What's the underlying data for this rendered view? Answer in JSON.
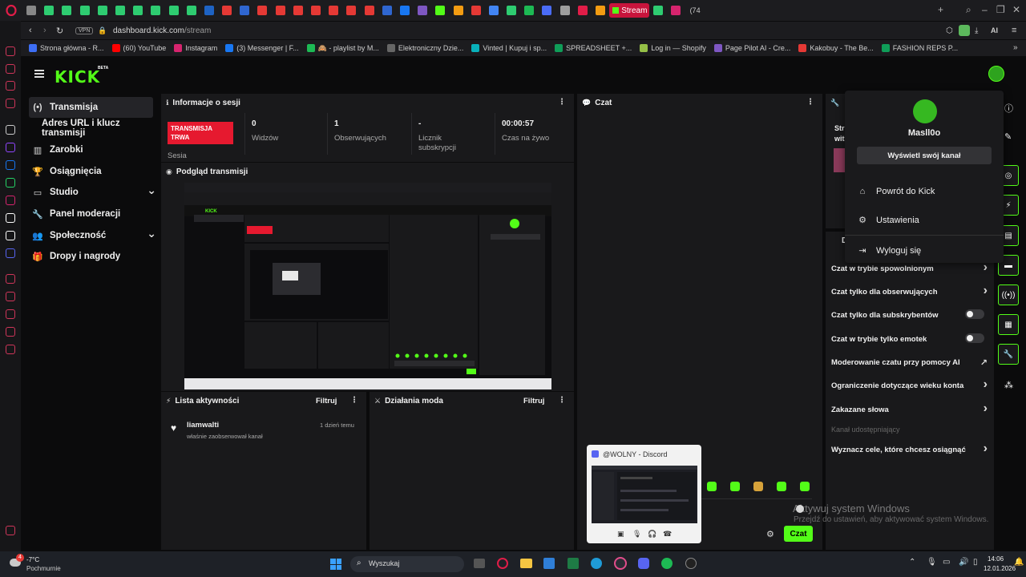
{
  "browser": {
    "url_domain": "dashboard.kick.com",
    "url_path": "/stream",
    "vpn_label": "VPN",
    "active_tab_label": "Stream",
    "tab_counter": "(74",
    "ai_label": "AI",
    "bookmarks": [
      {
        "label": "Strona główna - R...",
        "color": "#3d6ef5"
      },
      {
        "label": "(60) YouTube",
        "color": "#ff0000"
      },
      {
        "label": "Instagram",
        "color": "#d6246e"
      },
      {
        "label": "(3) Messenger | F...",
        "color": "#1877f2"
      },
      {
        "label": "🙈 - playlist by M...",
        "color": "#1db954"
      },
      {
        "label": "Elektroniczny Dzie...",
        "color": "#666666"
      },
      {
        "label": "Vinted | Kupuj i sp...",
        "color": "#09b1ba"
      },
      {
        "label": "SPREADSHEET +...",
        "color": "#0f9d58"
      },
      {
        "label": "Log in — Shopify",
        "color": "#95bf47"
      },
      {
        "label": "Page Pilot AI - Cre...",
        "color": "#7e57c2"
      },
      {
        "label": "Kakobuy - The Be...",
        "color": "#e53935"
      },
      {
        "label": "FASHION REPS P...",
        "color": "#0f9d58"
      }
    ]
  },
  "kick": {
    "logo": "KICK",
    "beta": "BETA",
    "nav": [
      {
        "label": "Transmisja",
        "icon": "broadcast-icon"
      },
      {
        "label": "Adres URL i klucz transmisji",
        "icon": ""
      },
      {
        "label": "Zarobki",
        "icon": "chart-icon"
      },
      {
        "label": "Osiągnięcia",
        "icon": "trophy-icon"
      },
      {
        "label": "Studio",
        "icon": "monitor-icon"
      },
      {
        "label": "Panel moderacji",
        "icon": "wrench-icon"
      },
      {
        "label": "Społeczność",
        "icon": "users-icon"
      },
      {
        "label": "Dropy i nagrody",
        "icon": "gift-icon"
      }
    ],
    "session": {
      "title": "Informacje o sesji",
      "live_badge": "TRANSMISJA TRWA",
      "sesja_label": "Sesia",
      "stats": [
        {
          "value": "0",
          "label": "Widzów"
        },
        {
          "value": "1",
          "label": "Obserwujących"
        },
        {
          "value": "-",
          "label": "Licznik subskrypcji"
        },
        {
          "value": "00:00:57",
          "label": "Czas na żywo"
        }
      ]
    },
    "preview_title": "Podgląd transmisji",
    "chat_title": "Czat",
    "chat_button": "Czat",
    "activity": {
      "title": "Lista aktywności",
      "filter": "Filtruj",
      "item_user": "liamwalti",
      "item_action": "właśnie zaobserwował kanał",
      "item_time": "1 dzień temu"
    },
    "mod": {
      "title": "Działania moda",
      "filter": "Filtruj"
    },
    "stream_info_partial": "Str",
    "stream_info_partial2": "wit",
    "settings_header_partial": "D",
    "settings": [
      {
        "label": "Czat w trybie spowolnionym",
        "control": "arrow"
      },
      {
        "label": "Czat tylko dla obserwujących",
        "control": "arrow"
      },
      {
        "label": "Czat tylko dla subskrybentów",
        "control": "toggle"
      },
      {
        "label": "Czat w trybie tylko emotek",
        "control": "toggle"
      },
      {
        "label": "Moderowanie czatu przy pomocy AI",
        "control": "external"
      },
      {
        "label": "Ograniczenie dotyczące wieku konta",
        "control": "arrow"
      },
      {
        "label": "Zakazane słowa",
        "control": "arrow"
      },
      {
        "label": "Kanał udostępniający",
        "control": "disabled"
      },
      {
        "label": "Wyznacz cele, które chcesz osiągnąć",
        "control": "arrow"
      }
    ],
    "user_menu": {
      "username": "Masll0o",
      "view_channel": "Wyświetl swój kanał",
      "items": [
        {
          "label": "Powrót do Kick",
          "icon": "home-icon"
        },
        {
          "label": "Ustawienia",
          "icon": "gear-icon"
        },
        {
          "label": "Wyloguj się",
          "icon": "logout-icon"
        }
      ]
    }
  },
  "discord_popup": {
    "title": "@WOLNY - Discord"
  },
  "windows": {
    "activation_title": "Aktywuj system Windows",
    "activation_sub": "Przejdź do ustawień, aby aktywować system Windows.",
    "weather_temp": "-7°C",
    "weather_desc": "Pochmurnie",
    "search_placeholder": "Wyszukaj",
    "time": "14:06",
    "date": "12.01.2026",
    "weather_badge": "4"
  },
  "colors": {
    "kick_green": "#53fc18",
    "live_red": "#e6192f",
    "panel_bg": "#19191b"
  }
}
